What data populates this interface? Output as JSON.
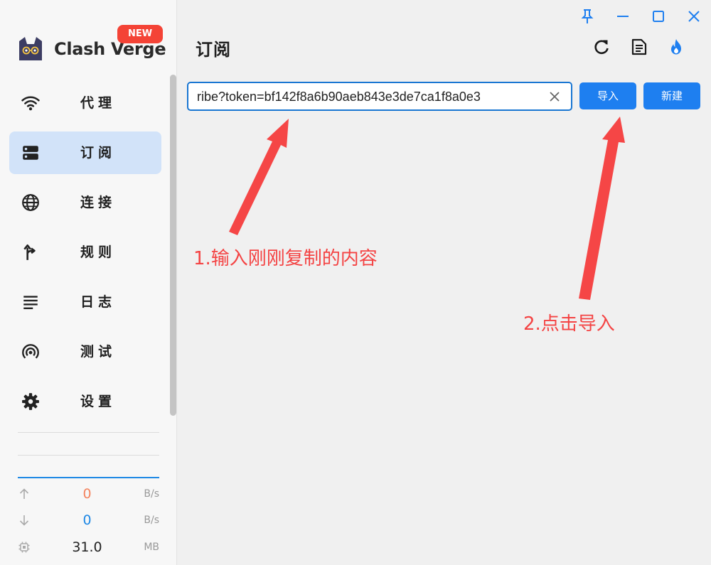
{
  "app": {
    "name": "Clash Verge",
    "badge": "NEW"
  },
  "sidebar": {
    "items": [
      {
        "label": "代理",
        "icon": "wifi-icon",
        "active": false
      },
      {
        "label": "订阅",
        "icon": "storage-icon",
        "active": true
      },
      {
        "label": "连接",
        "icon": "globe-icon",
        "active": false
      },
      {
        "label": "规则",
        "icon": "fork-arrow-icon",
        "active": false
      },
      {
        "label": "日志",
        "icon": "list-lines-icon",
        "active": false
      },
      {
        "label": "测试",
        "icon": "radar-icon",
        "active": false
      },
      {
        "label": "设置",
        "icon": "gear-icon",
        "active": false
      }
    ]
  },
  "traffic": {
    "upload": {
      "value": "0",
      "unit": "B/s",
      "color": "#f4845f"
    },
    "download": {
      "value": "0",
      "unit": "B/s",
      "color": "#1e88e5"
    },
    "memory": {
      "value": "31.0",
      "unit": "MB"
    }
  },
  "header": {
    "title": "订阅"
  },
  "subscription": {
    "url_value": "ribe?token=bf142f8a6b90aeb843e3de7ca1f8a0e3",
    "import_label": "导入",
    "new_label": "新建"
  },
  "annotations": {
    "step1": "1.输入刚刚复制的内容",
    "step2": "2.点击导入"
  },
  "colors": {
    "accent": "#1e7ff0",
    "active_nav": "#d2e3f9",
    "annotation": "#f44343",
    "badge": "#f44336"
  }
}
